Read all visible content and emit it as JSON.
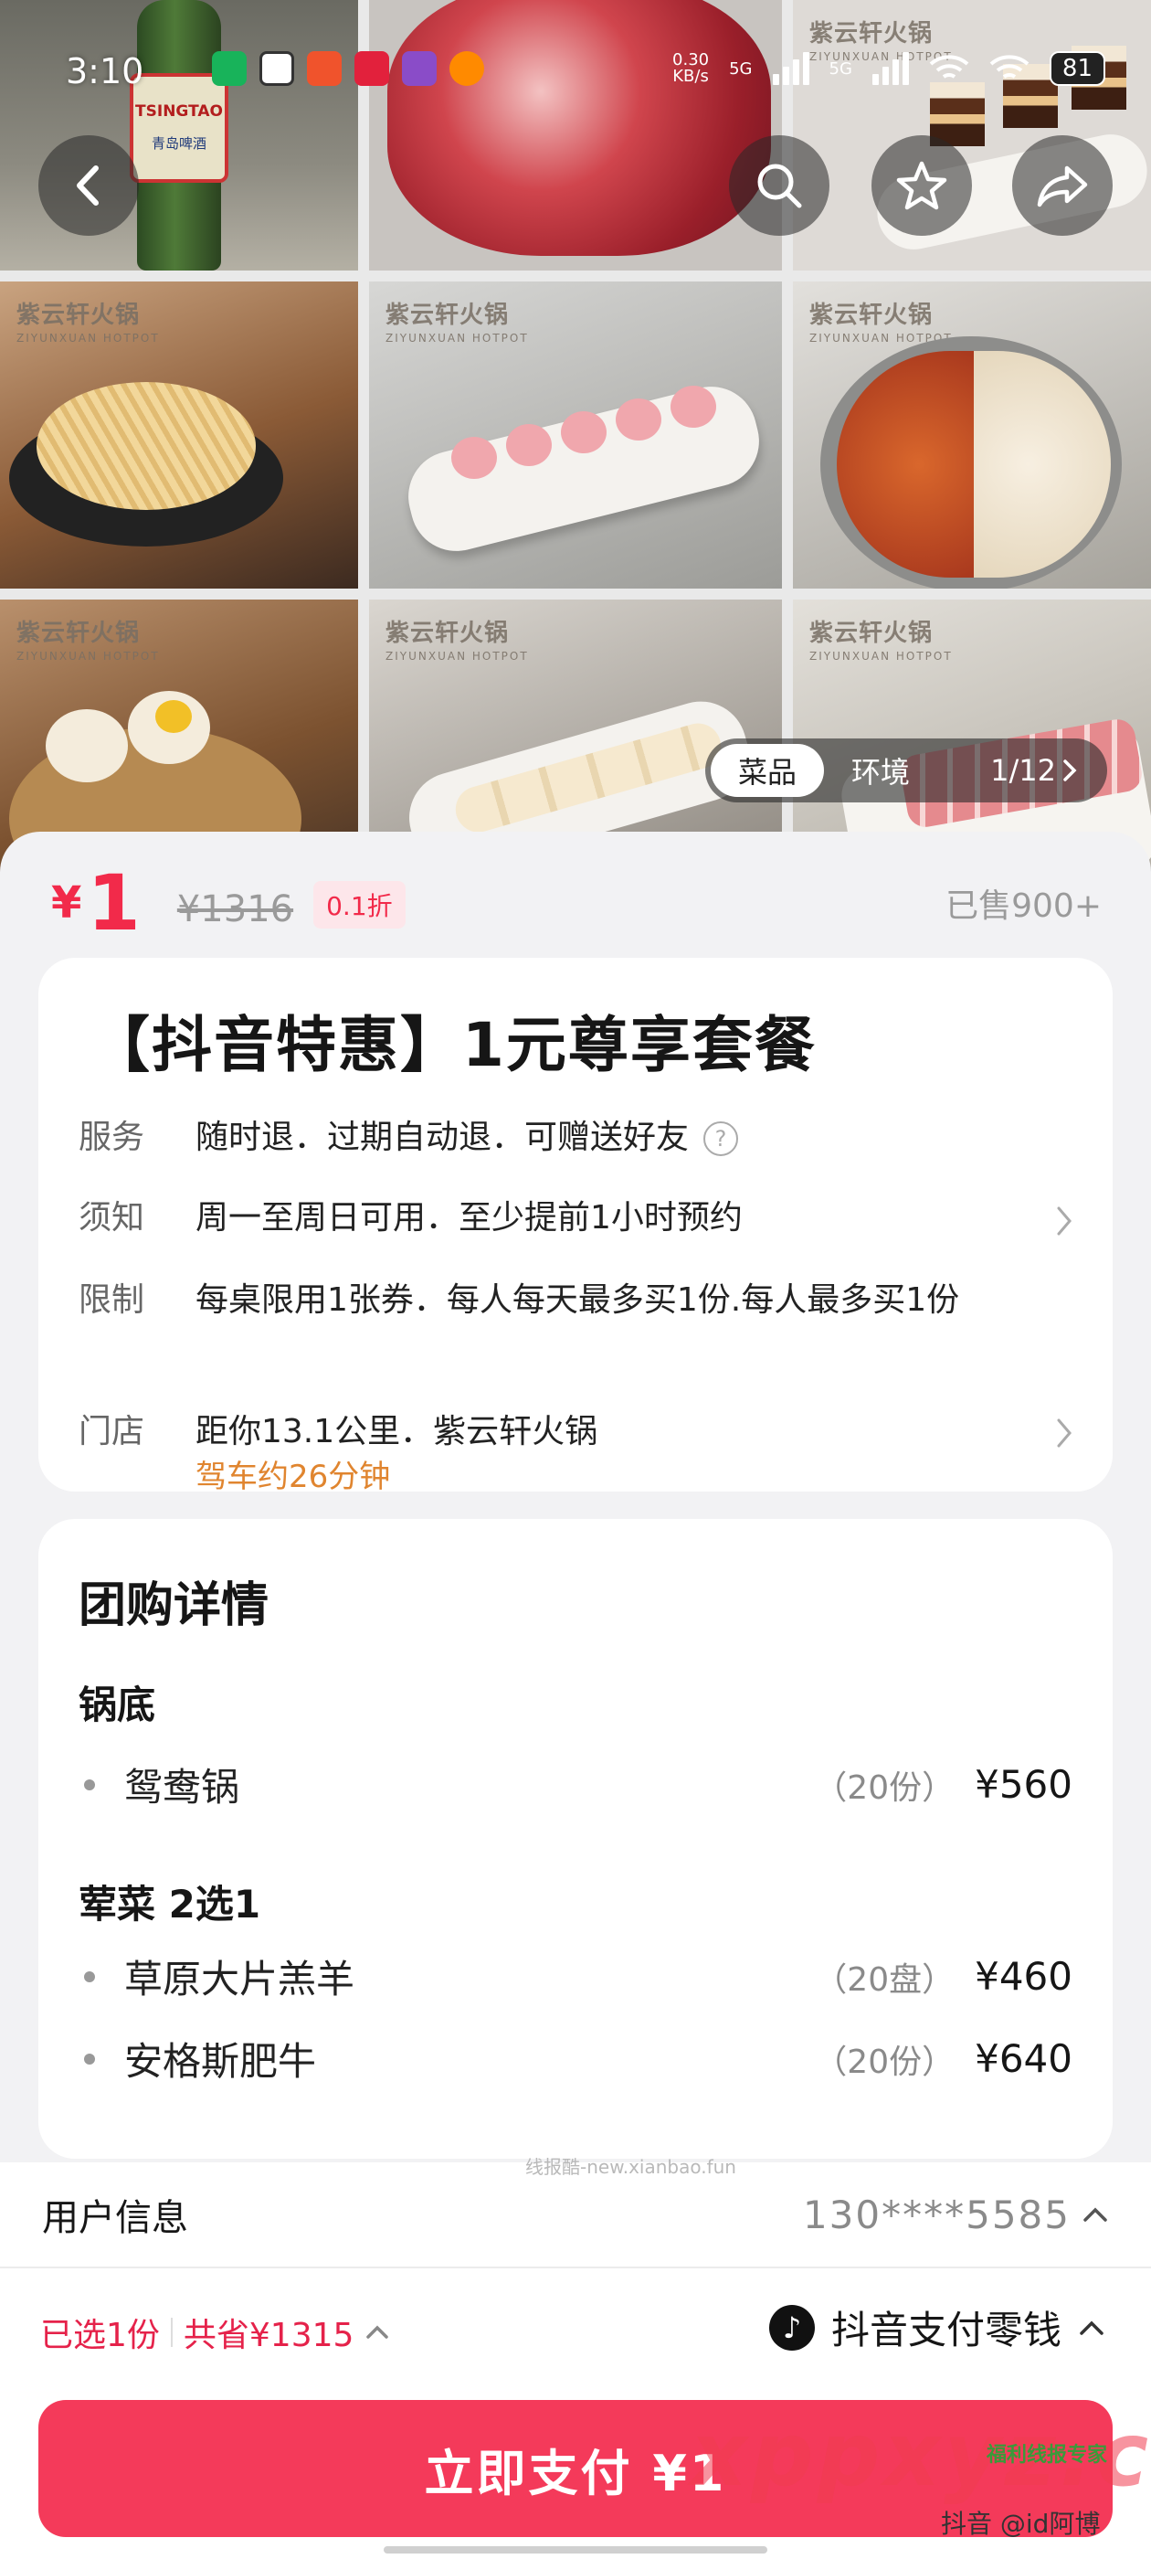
{
  "status_bar": {
    "time": "3:10",
    "net_speed_value": "0.30",
    "net_speed_unit": "KB/s",
    "sim1": "5G",
    "sim2": "5G",
    "battery": "81"
  },
  "gallery": {
    "brand_cn": "紫云轩火锅",
    "brand_en": "ZIYUNXUAN HOTPOT",
    "beer_label": "TSINGTAO",
    "beer_label_cn": "青岛啤酒",
    "tabs": [
      {
        "label": "菜品",
        "active": true
      },
      {
        "label": "环境",
        "active": false
      }
    ],
    "counter": "1/12"
  },
  "price": {
    "currency": "¥",
    "current": "1",
    "original": "¥1316",
    "discount": "0.1折",
    "sold": "已售900+"
  },
  "deal": {
    "title": "【抖音特惠】1元尊享套餐",
    "rows": [
      {
        "label": "服务",
        "value": "随时退．过期自动退．可赠送好友"
      },
      {
        "label": "须知",
        "value": "周一至周日可用．至少提前1小时预约"
      },
      {
        "label": "限制",
        "value": "每桌限用1张券．每人每天最多买1份.每人最多买1份"
      },
      {
        "label": "门店",
        "value": "距你13.1公里．紫云轩火锅",
        "sub": "驾车约26分钟"
      }
    ]
  },
  "details": {
    "title": "团购详情",
    "groups": [
      {
        "title": "锅底",
        "items": [
          {
            "name": "鸳鸯锅",
            "qty": "（20份）",
            "price": "¥560"
          }
        ]
      },
      {
        "title": "荤菜 2选1",
        "items": [
          {
            "name": "草原大片羔羊",
            "qty": "（20盘）",
            "price": "¥460"
          },
          {
            "name": "安格斯肥牛",
            "qty": "（20份）",
            "price": "¥640"
          }
        ]
      }
    ]
  },
  "watermark_top": "线报酷-new.xianbao.fun",
  "user": {
    "label": "用户信息",
    "phone": "130****5585"
  },
  "pay": {
    "selected": "已选1份",
    "saved": "共省¥1315",
    "method": "抖音支付零钱",
    "button": "立即支付 ¥1"
  },
  "overlay_watermarks": {
    "brand": "xppxyz.com",
    "tag": "福利线报专家",
    "user": "抖音 @id阿博"
  },
  "colors": {
    "accent": "#f22a4a",
    "button": "#f43a5a",
    "orange": "#e0852f"
  }
}
